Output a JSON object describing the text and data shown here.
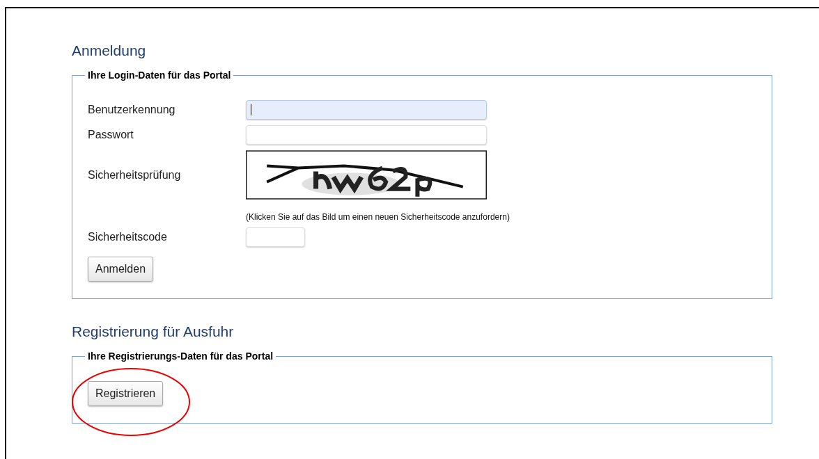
{
  "sections": [
    {
      "title": "Anmeldung",
      "legend": "Ihre Login-Daten für das Portal",
      "rows": [
        {
          "kind": "text",
          "label": "Benutzerkennung",
          "focused": true
        },
        {
          "kind": "password",
          "label": "Passwort",
          "focused": false
        },
        {
          "kind": "captcha",
          "label": "Sicherheitsprüfung",
          "hint": "(Klicken Sie auf das Bild um einen neuen Sicherheitscode anzufordern)"
        },
        {
          "kind": "code",
          "label": "Sicherheitscode",
          "focused": false
        }
      ],
      "button": {
        "label": "Anmelden"
      }
    },
    {
      "title": "Registrierung für Ausfuhr",
      "legend": "Ihre Registrierungs-Daten für das Portal",
      "button": {
        "label": "Registrieren"
      },
      "annotation": {
        "kind": "ellipse"
      }
    }
  ]
}
